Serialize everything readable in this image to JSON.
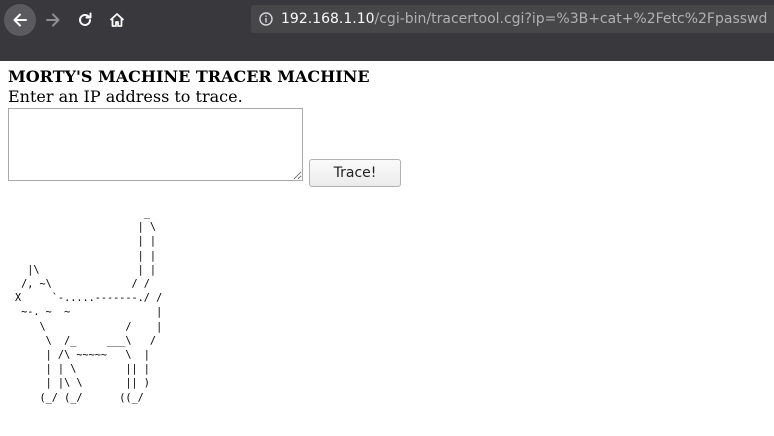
{
  "browser": {
    "url_host": "192.168.1.10",
    "url_rest": "/cgi-bin/tracertool.cgi?ip=%3B+cat+%2Fetc%2Fpasswd"
  },
  "page": {
    "title": "MORTY'S MACHINE TRACER MACHINE",
    "prompt": "Enter an IP address to trace.",
    "input_value": "",
    "button_label": "Trace!",
    "ascii_art": "                     _\n                    | \\\n                    | |\n                    | |\n  |\\                | |\n /, ~\\             / /\nX     `-.....-------./ /\n ~-. ~  ~              |\n    \\             /    |\n     \\  /_     ___\\   /\n     | /\\ ~~~~~   \\  |\n     | | \\        || |\n     | |\\ \\       || )\n    (_/ (_/      ((_/"
  }
}
